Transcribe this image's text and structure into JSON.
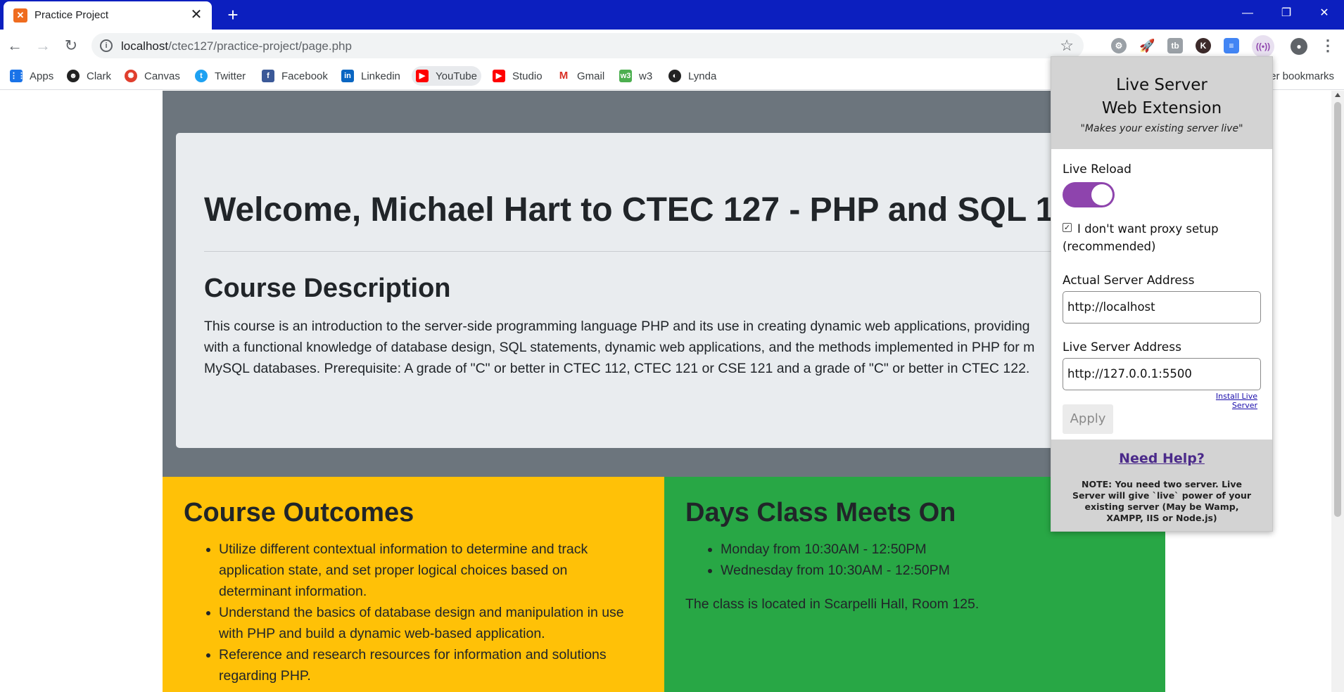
{
  "browser": {
    "tab_title": "Practice Project",
    "tab_close": "✕",
    "new_tab": "+",
    "window_controls": {
      "minimize": "—",
      "restore": "❐",
      "close": "✕"
    },
    "url_host": "localhost",
    "url_path": "/ctec127/practice-project/page.php",
    "bookmarks": [
      {
        "label": "Apps",
        "icon": "apps-grid-icon",
        "color": "#1a73e8"
      },
      {
        "label": "Clark",
        "icon": "clark-logo-icon",
        "color": "#222222"
      },
      {
        "label": "Canvas",
        "icon": "canvas-logo-icon",
        "color": "#e03e2d"
      },
      {
        "label": "Twitter",
        "icon": "twitter-icon",
        "color": "#1da1f2"
      },
      {
        "label": "Facebook",
        "icon": "facebook-icon",
        "color": "#3b5998"
      },
      {
        "label": "Linkedin",
        "icon": "linkedin-icon",
        "color": "#0a66c2"
      },
      {
        "label": "YouTube",
        "icon": "youtube-icon",
        "color": "#ff0000"
      },
      {
        "label": "Studio",
        "icon": "youtube-studio-icon",
        "color": "#ff0000"
      },
      {
        "label": "Gmail",
        "icon": "gmail-icon",
        "color": "#d93025"
      },
      {
        "label": "w3",
        "icon": "w3schools-icon",
        "color": "#4caf50"
      },
      {
        "label": "Lynda",
        "icon": "lynda-icon",
        "color": "#222222"
      }
    ],
    "other_bookmarks": "er bookmarks"
  },
  "page": {
    "welcome": "Welcome, Michael Hart to CTEC 127 - PHP and SQL 1",
    "description_heading": "Course Description",
    "description_lines": [
      "This course is an introduction to the server-side programming language PHP and its use in creating dynamic web applications, providing",
      "with a functional knowledge of database design, SQL statements, dynamic web applications, and the methods implemented in PHP for m",
      "MySQL databases. Prerequisite: A grade of \"C\" or better in CTEC 112, CTEC 121 or CSE 121 and a grade of \"C\" or better in CTEC 122."
    ],
    "outcomes_heading": "Course Outcomes",
    "outcomes": [
      "Utilize different contextual information to determine and track application state, and set proper logical choices based on determinant information.",
      "Understand the basics of database design and manipulation in use with PHP and build a dynamic web-based application.",
      "Reference and research resources for information and solutions regarding PHP."
    ],
    "days_heading": "Days Class Meets On",
    "days": [
      "Monday from 10:30AM - 12:50PM",
      "Wednesday from 10:30AM - 12:50PM"
    ],
    "location": "The class is located in Scarpelli Hall, Room 125."
  },
  "popup": {
    "title_line1": "Live Server",
    "title_line2": "Web Extension",
    "tagline": "\"Makes your existing server live\"",
    "live_reload_label": "Live Reload",
    "live_reload_on": true,
    "proxy_checkbox_text": "I don't want proxy setup (recommended)",
    "proxy_checked": true,
    "actual_server_label": "Actual Server Address",
    "actual_server_value": "http://localhost",
    "live_server_label": "Live Server Address",
    "live_server_value": "http://127.0.0.1:5500",
    "install_link": "Install Live Server",
    "apply_label": "Apply",
    "help_label": "Need Help?",
    "note": "NOTE: You need two server. Live Server will give `live` power of your existing server (May be Wamp, XAMPP, IIS or Node.js)",
    "accent_color": "#8e44ad"
  }
}
